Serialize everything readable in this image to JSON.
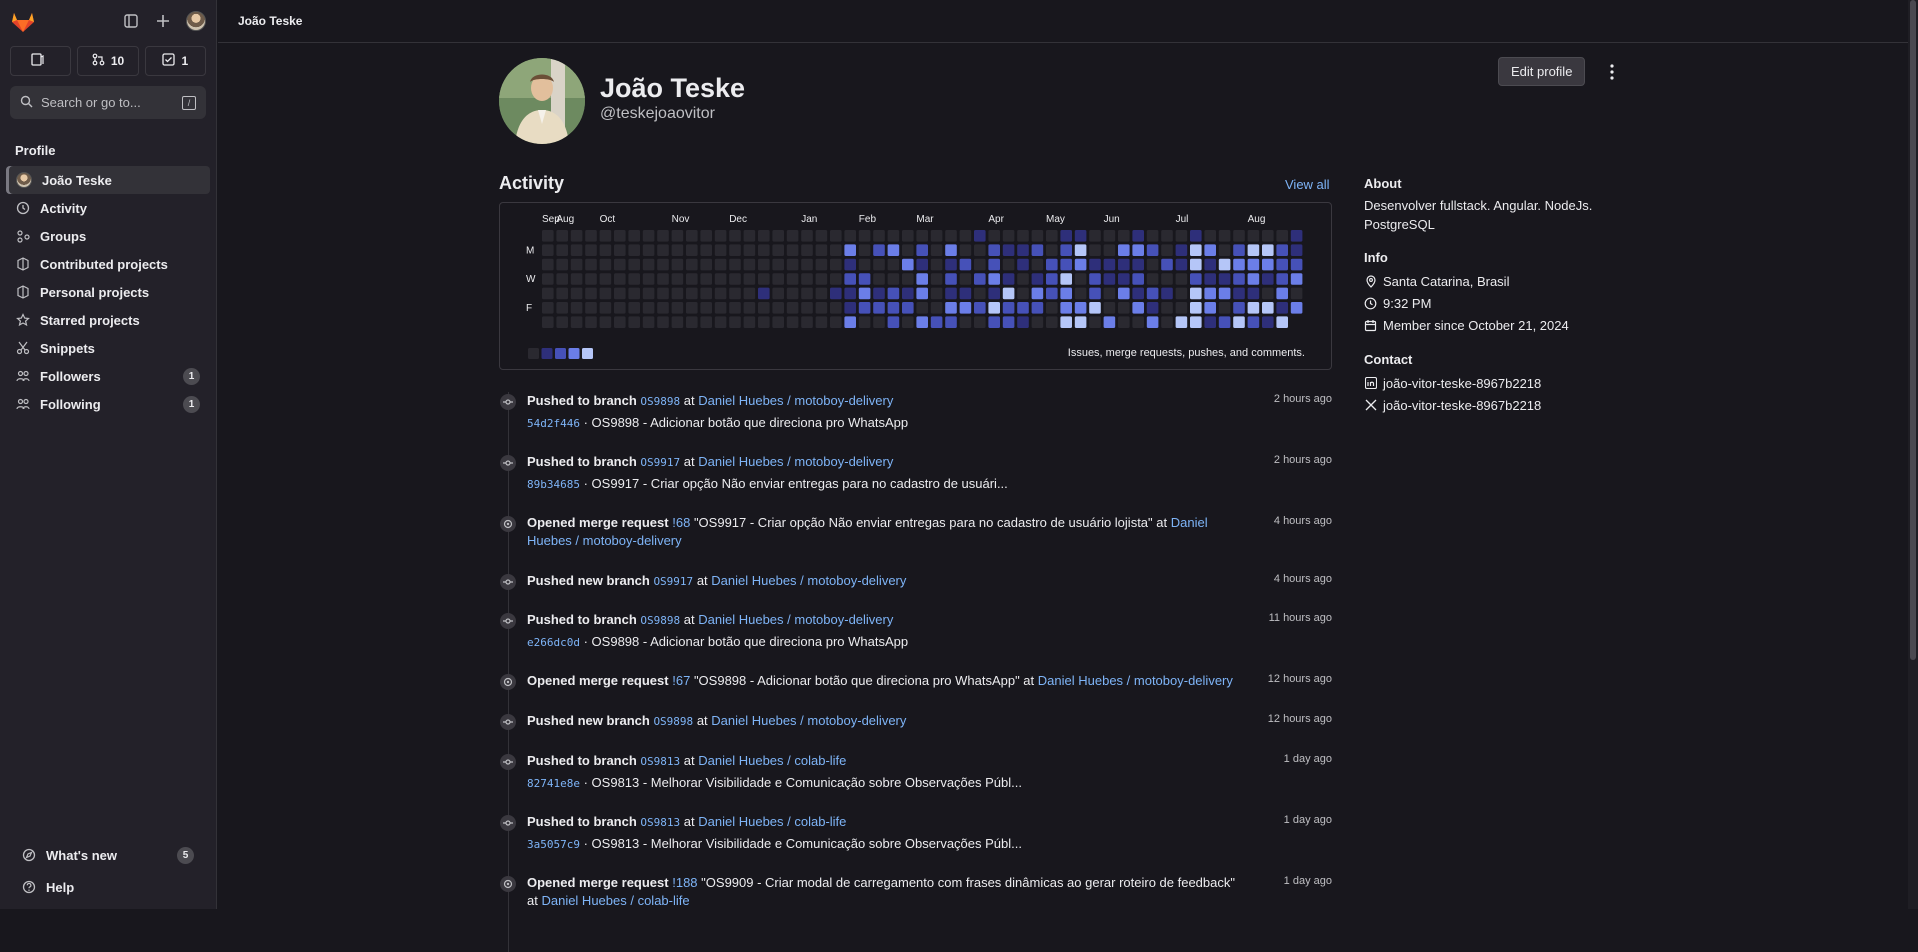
{
  "sidebar": {
    "counters": [
      {
        "icon": "issues-icon",
        "count": ""
      },
      {
        "icon": "merge-request-icon",
        "count": "10"
      },
      {
        "icon": "todo-icon",
        "count": "1"
      }
    ],
    "search_placeholder": "Search or go to...",
    "search_shortcut": "/",
    "section_title": "Profile",
    "items": [
      {
        "label": "João Teske",
        "icon": "avatar"
      },
      {
        "label": "Activity",
        "icon": "history-icon"
      },
      {
        "label": "Groups",
        "icon": "group-icon"
      },
      {
        "label": "Contributed projects",
        "icon": "project-icon"
      },
      {
        "label": "Personal projects",
        "icon": "project-icon"
      },
      {
        "label": "Starred projects",
        "icon": "star-icon"
      },
      {
        "label": "Snippets",
        "icon": "snippet-icon"
      },
      {
        "label": "Followers",
        "icon": "users-icon",
        "badge": "1"
      },
      {
        "label": "Following",
        "icon": "users-icon",
        "badge": "1"
      }
    ],
    "bottom": [
      {
        "label": "What's new",
        "icon": "compass-icon",
        "badge": "5"
      },
      {
        "label": "Help",
        "icon": "help-icon"
      }
    ]
  },
  "topbar": {
    "breadcrumb": "João Teske"
  },
  "profile": {
    "name": "João Teske",
    "handle": "@teskejoaovitor",
    "edit_button": "Edit profile"
  },
  "activity": {
    "title": "Activity",
    "view_all": "View all",
    "months": [
      "Aug",
      "Sep",
      "Oct",
      "Nov",
      "Dec",
      "Jan",
      "Feb",
      "Mar",
      "Apr",
      "May",
      "Jun",
      "Jul",
      "Aug"
    ],
    "days": [
      "M",
      "W",
      "F"
    ],
    "legend_text": "Issues, merge requests, pushes, and comments."
  },
  "events": [
    {
      "action": "Pushed to branch",
      "ref": "OS9898",
      "at": "at",
      "project": "Daniel Huebes / motoboy-delivery",
      "sha": "54d2f446",
      "message": "· OS9898 - Adicionar botão que direciona pro WhatsApp",
      "time": "2 hours ago",
      "icon": "commit-icon"
    },
    {
      "action": "Pushed to branch",
      "ref": "OS9917",
      "at": "at",
      "project": "Daniel Huebes / motoboy-delivery",
      "sha": "89b34685",
      "message": "· OS9917 - Criar opção Não enviar entregas para no cadastro de usuári...",
      "time": "2 hours ago",
      "icon": "commit-icon"
    },
    {
      "action": "Opened merge request",
      "ref": "!68",
      "title": "\"OS9917 - Criar opção Não enviar entregas para no cadastro de usuário lojista\" at",
      "project": "Daniel Huebes / motoboy-delivery",
      "time": "4 hours ago",
      "icon": "merge-request-open-icon"
    },
    {
      "action": "Pushed new branch",
      "ref": "OS9917",
      "at": "at",
      "project": "Daniel Huebes / motoboy-delivery",
      "time": "4 hours ago",
      "icon": "commit-icon"
    },
    {
      "action": "Pushed to branch",
      "ref": "OS9898",
      "at": "at",
      "project": "Daniel Huebes / motoboy-delivery",
      "sha": "e266dc0d",
      "message": "· OS9898 - Adicionar botão que direciona pro WhatsApp",
      "time": "11 hours ago",
      "icon": "commit-icon"
    },
    {
      "action": "Opened merge request",
      "ref": "!67",
      "title": "\"OS9898 - Adicionar botão que direciona pro WhatsApp\" at",
      "project": "Daniel Huebes / motoboy-delivery",
      "time": "12 hours ago",
      "icon": "merge-request-open-icon"
    },
    {
      "action": "Pushed new branch",
      "ref": "OS9898",
      "at": "at",
      "project": "Daniel Huebes / motoboy-delivery",
      "time": "12 hours ago",
      "icon": "commit-icon"
    },
    {
      "action": "Pushed to branch",
      "ref": "OS9813",
      "at": "at",
      "project": "Daniel Huebes / colab-life",
      "sha": "82741e8e",
      "message": "· OS9813 - Melhorar Visibilidade e Comunicação sobre Observações Públ...",
      "time": "1 day ago",
      "icon": "commit-icon"
    },
    {
      "action": "Pushed to branch",
      "ref": "OS9813",
      "at": "at",
      "project": "Daniel Huebes / colab-life",
      "sha": "3a5057c9",
      "message": "· OS9813 - Melhorar Visibilidade e Comunicação sobre Observações Públ...",
      "time": "1 day ago",
      "icon": "commit-icon"
    },
    {
      "action": "Opened merge request",
      "ref": "!188",
      "title": "\"OS9909 - Criar modal de carregamento com frases dinâmicas ao gerar roteiro de feedback\" at",
      "project": "Daniel Huebes / colab-life",
      "time": "1 day ago",
      "icon": "merge-request-open-icon"
    }
  ],
  "about": {
    "title": "About",
    "bio": "Desenvolver fullstack. Angular. NodeJs. PostgreSQL",
    "info_title": "Info",
    "location": "Santa Catarina, Brasil",
    "local_time": "9:32 PM",
    "member_since": "Member since October 21, 2024",
    "contact_title": "Contact",
    "linkedin": "joão-vitor-teske-8967b2218",
    "twitter": "joão-vitor-teske-8967b2218"
  },
  "colors": {
    "background": "#18171d",
    "sidebar": "#232129",
    "link": "#7eb4f7",
    "heat_levels": [
      "#2a2930",
      "#2e2f7a",
      "#4651b8",
      "#6b7ee8",
      "#b5c6f8"
    ]
  }
}
